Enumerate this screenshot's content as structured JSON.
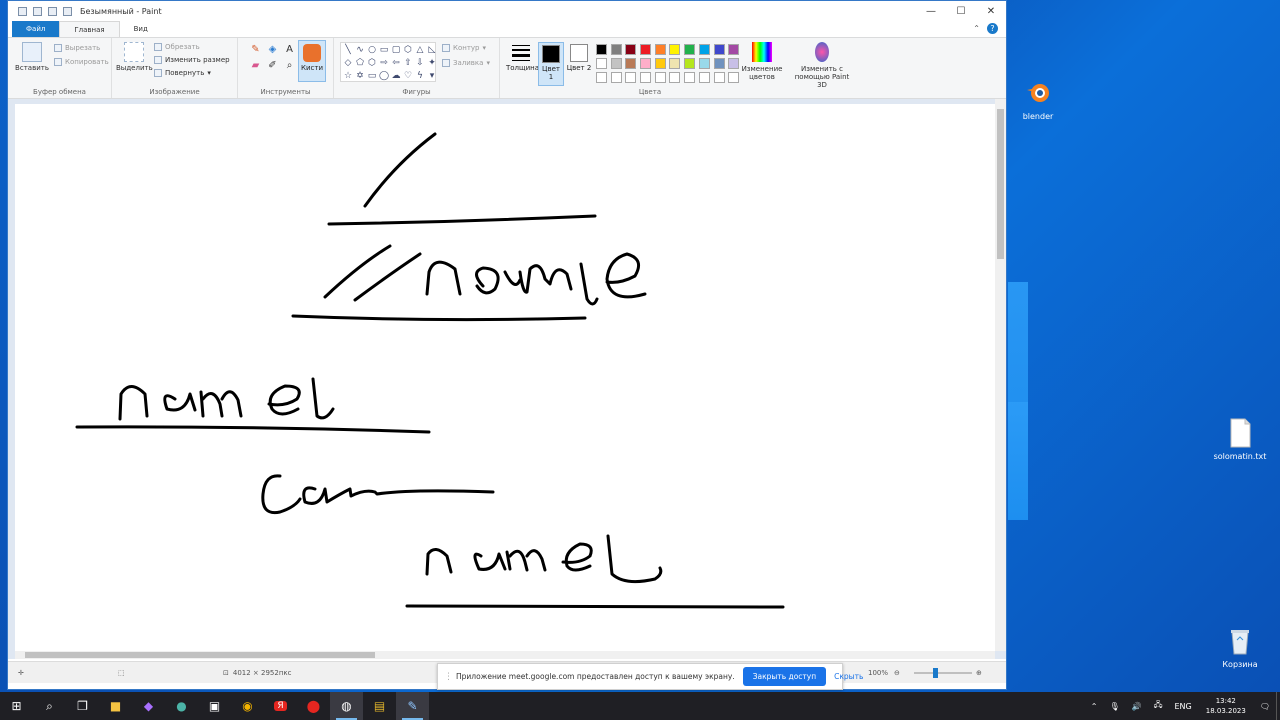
{
  "window": {
    "title": "Безымянный - Paint",
    "minimize": "—",
    "maximize": "☐",
    "close": "✕"
  },
  "tabs": {
    "file": "Файл",
    "home": "Главная",
    "view": "Вид",
    "help": "?"
  },
  "ribbon": {
    "clipboard": {
      "label": "Буфер обмена",
      "paste": "Вставить",
      "cut": "Вырезать",
      "copy": "Копировать"
    },
    "image": {
      "label": "Изображение",
      "select": "Выделить",
      "crop": "Обрезать",
      "resize": "Изменить размер",
      "rotate": "Повернуть"
    },
    "tools": {
      "label": "Инструменты",
      "brushes": "Кисти"
    },
    "shapes": {
      "label": "Фигуры",
      "outline": "Контур",
      "fill": "Заливка"
    },
    "colors": {
      "label": "Цвета",
      "thickness": "Толщина",
      "color1": "Цвет 1",
      "color2": "Цвет 2",
      "edit": "Изменение цветов",
      "paint3d": "Изменить с помощью Paint 3D",
      "color1_value": "#000000",
      "color2_value": "#ffffff",
      "palette": [
        "#000000",
        "#7f7f7f",
        "#880015",
        "#ed1c24",
        "#ff7f27",
        "#fff200",
        "#22b14c",
        "#00a2e8",
        "#3f48cc",
        "#a349a4",
        "#ffffff",
        "#c3c3c3",
        "#b97a57",
        "#ffaec9",
        "#ffc90e",
        "#efe4b0",
        "#b5e61d",
        "#99d9ea",
        "#7092be",
        "#c8bfe7",
        "#ffffff",
        "#ffffff",
        "#ffffff",
        "#ffffff",
        "#ffffff",
        "#ffffff",
        "#ffffff",
        "#ffffff",
        "#ffffff",
        "#ffffff"
      ]
    }
  },
  "status": {
    "dimensions": "4012 × 2952пкс",
    "zoom": "100%",
    "zoom_level_percent": 100
  },
  "share_bar": {
    "message": "Приложение meet.google.com предоставлен доступ к вашему экрану.",
    "stop": "Закрыть доступ",
    "hide": "Скрыть"
  },
  "desktop": {
    "icons": [
      {
        "label": "blender"
      },
      {
        "label": "solomatin.txt"
      },
      {
        "label": "Корзина"
      }
    ]
  },
  "taskbar": {
    "lang": "ENG",
    "time": "13:42",
    "date": "18.03.2023"
  }
}
